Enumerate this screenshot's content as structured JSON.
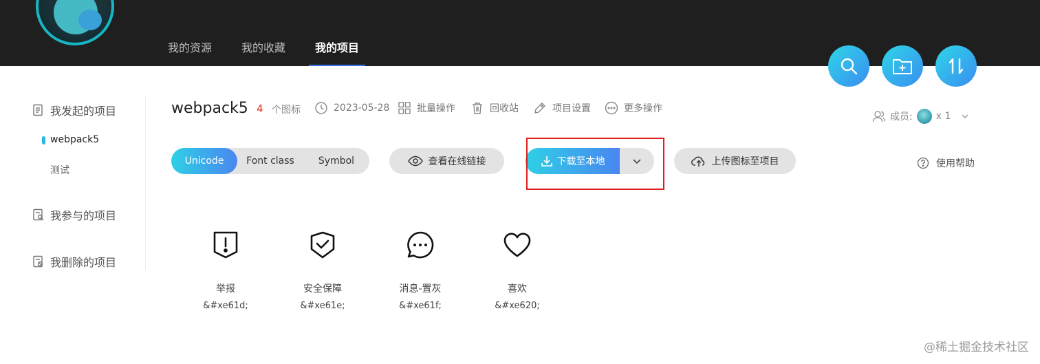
{
  "topnav": {
    "tabs": [
      {
        "label": "我的资源"
      },
      {
        "label": "我的收藏"
      },
      {
        "label": "我的项目"
      }
    ],
    "fabs": [
      "search-icon",
      "add-folder-icon",
      "sort-icon"
    ]
  },
  "sidebar": {
    "group_started": "我发起的项目",
    "items": [
      {
        "label": "webpack5"
      },
      {
        "label": "测试"
      }
    ],
    "group_joined": "我参与的项目",
    "group_deleted": "我删除的项目"
  },
  "project": {
    "name": "webpack5",
    "icon_count": "4",
    "icon_count_unit": "个图标",
    "date": "2023-05-28",
    "batch": "批量操作",
    "recycle": "回收站",
    "settings": "项目设置",
    "more": "更多操作",
    "members_label": "成员:",
    "members_count": "x 1"
  },
  "toolbar": {
    "formats": [
      {
        "label": "Unicode"
      },
      {
        "label": "Font class"
      },
      {
        "label": "Symbol"
      }
    ],
    "view_link": "查看在线链接",
    "download": "下载至本地",
    "upload": "上传图标至项目",
    "help": "使用帮助"
  },
  "icons": [
    {
      "name": "举报",
      "code": "&#xe61d;",
      "icon": "report-icon"
    },
    {
      "name": "安全保障",
      "code": "&#xe61e;",
      "icon": "shield-check-icon"
    },
    {
      "name": "消息-置灰",
      "code": "&#xe61f;",
      "icon": "message-icon"
    },
    {
      "name": "喜欢",
      "code": "&#xe620;",
      "icon": "heart-icon"
    }
  ],
  "watermark": "@稀土掘金技术社区",
  "colors": {
    "accent_start": "#2ed0e6",
    "accent_end": "#4a86f0",
    "highlight": "#e01e1e",
    "count": "#e0301e"
  }
}
